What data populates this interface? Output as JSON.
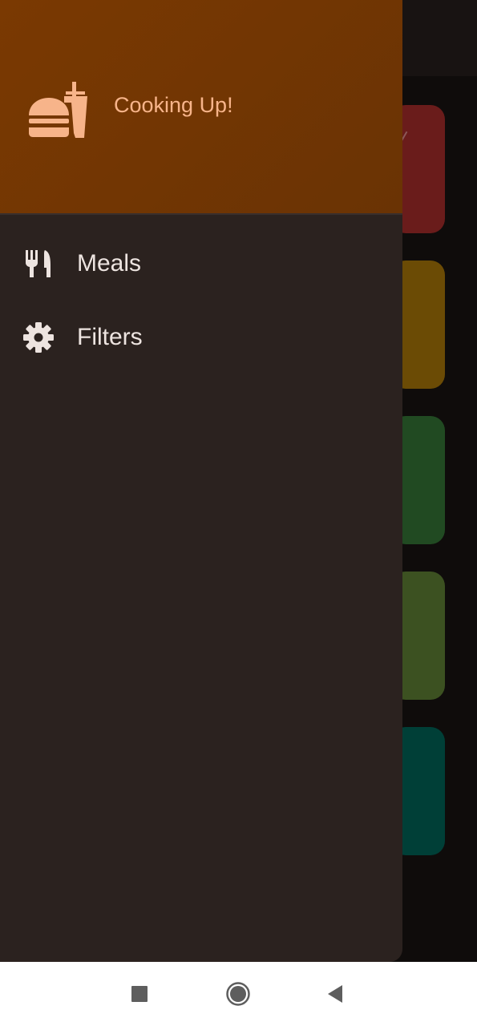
{
  "app": {
    "drawer_title": "Cooking Up!",
    "header_icon": "fastfood-icon"
  },
  "drawer": {
    "items": [
      {
        "label": "Meals",
        "icon": "restaurant-icon"
      },
      {
        "label": "Filters",
        "icon": "settings-icon"
      }
    ]
  },
  "background": {
    "category_card_colors": [
      "#6a1c1b",
      "#6b4b05",
      "#214a22",
      "#3c5121",
      "#003f37"
    ]
  },
  "colors": {
    "header_gradient_start": "#7a3902",
    "header_gradient_end": "#6a3304",
    "header_accent": "#f7b48a",
    "drawer_background": "#2b221f",
    "drawer_text": "#ede4e0",
    "navbar_background": "#ffffff",
    "navbar_icon": "#5e5e5e"
  },
  "system_nav": {
    "buttons": [
      "recents-icon",
      "home-icon",
      "back-icon"
    ]
  }
}
